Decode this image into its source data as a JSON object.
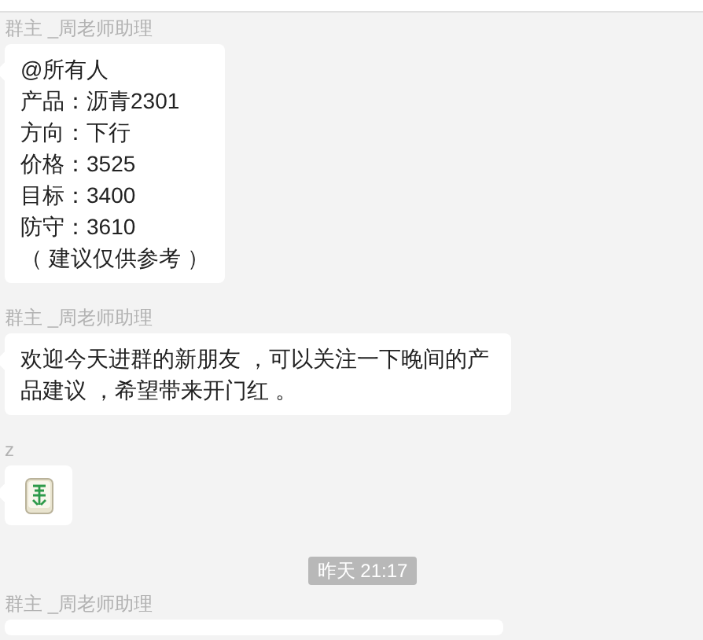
{
  "messages": [
    {
      "sender": "群主 _周老师助理",
      "kind": "text",
      "lines": [
        "@所有人",
        "产品：沥青2301",
        "方向：下行",
        "价格：3525",
        "目标：3400",
        "防守：3610",
        "（ 建议仅供参考 ）"
      ]
    },
    {
      "sender": "群主 _周老师助理",
      "kind": "text",
      "lines": [
        "欢迎今天进群的新朋友 ，可以关注一下晚间的产品建议 ，希望带来开门红 。"
      ]
    },
    {
      "sender": "z",
      "kind": "sticker"
    },
    {
      "kind": "time",
      "time": "昨天 21:17"
    },
    {
      "sender": "群主 _周老师助理",
      "kind": "clipped"
    }
  ]
}
